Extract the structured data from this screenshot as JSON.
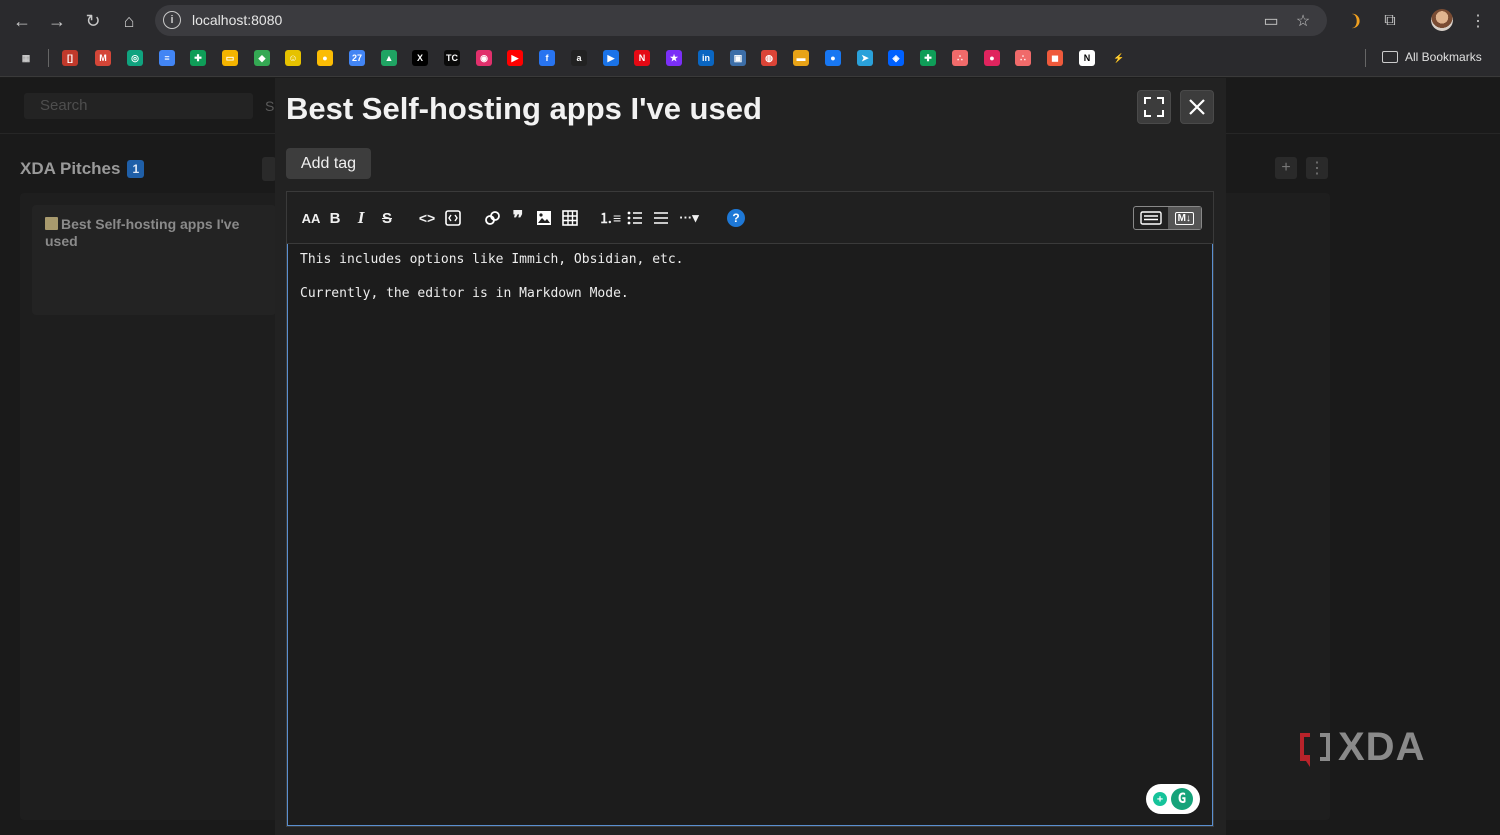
{
  "browser": {
    "url": "localhost:8080",
    "all_bookmarks_label": "All Bookmarks"
  },
  "bookmarks": [
    {
      "icon": "apps-icon",
      "color": "#2a2a2d",
      "glyph": "▦"
    },
    {
      "icon": "bracket-icon",
      "color": "#c0392b",
      "glyph": "[]"
    },
    {
      "icon": "gmail-icon",
      "color": "#d44638",
      "glyph": "M"
    },
    {
      "icon": "chatgpt-icon",
      "color": "#10a37f",
      "glyph": "◎"
    },
    {
      "icon": "docs-icon",
      "color": "#4285f4",
      "glyph": "≡"
    },
    {
      "icon": "sheets-icon",
      "color": "#0f9d58",
      "glyph": "✚"
    },
    {
      "icon": "slides-icon",
      "color": "#f4b400",
      "glyph": "▭"
    },
    {
      "icon": "chat-icon",
      "color": "#34a853",
      "glyph": "◆"
    },
    {
      "icon": "smiley-icon",
      "color": "#e6c200",
      "glyph": "☺"
    },
    {
      "icon": "keep-icon",
      "color": "#fbbc04",
      "glyph": "●"
    },
    {
      "icon": "calendar-icon",
      "color": "#4285f4",
      "glyph": "27"
    },
    {
      "icon": "drive-icon",
      "color": "#1fa463",
      "glyph": "▲"
    },
    {
      "icon": "x-icon",
      "color": "#000000",
      "glyph": "X"
    },
    {
      "icon": "tc-icon",
      "color": "#0a0a0a",
      "glyph": "TC"
    },
    {
      "icon": "instagram-icon",
      "color": "#e1306c",
      "glyph": "◉"
    },
    {
      "icon": "youtube-icon",
      "color": "#ff0000",
      "glyph": "▶"
    },
    {
      "icon": "flipkart-icon",
      "color": "#2874f0",
      "glyph": "f"
    },
    {
      "icon": "amazon-icon",
      "color": "#222222",
      "glyph": "a"
    },
    {
      "icon": "play-icon",
      "color": "#1a73e8",
      "glyph": "▶"
    },
    {
      "icon": "netflix-icon",
      "color": "#e50914",
      "glyph": "N"
    },
    {
      "icon": "star-app-icon",
      "color": "#7b2ff7",
      "glyph": "★"
    },
    {
      "icon": "linkedin-icon",
      "color": "#0a66c2",
      "glyph": "in"
    },
    {
      "icon": "news-icon",
      "color": "#3c6ea8",
      "glyph": "▣"
    },
    {
      "icon": "chrome-icon",
      "color": "#db4437",
      "glyph": "◍"
    },
    {
      "icon": "box-icon",
      "color": "#e8a317",
      "glyph": "▬"
    },
    {
      "icon": "message-icon",
      "color": "#1877f2",
      "glyph": "●"
    },
    {
      "icon": "telegram-icon",
      "color": "#2aa1da",
      "glyph": "➤"
    },
    {
      "icon": "dropbox-icon",
      "color": "#0061ff",
      "glyph": "◈"
    },
    {
      "icon": "sheets2-icon",
      "color": "#0f9d58",
      "glyph": "✚"
    },
    {
      "icon": "asana-icon",
      "color": "#f06a6a",
      "glyph": "∴"
    },
    {
      "icon": "red-circle-icon",
      "color": "#e0245e",
      "glyph": "●"
    },
    {
      "icon": "asana2-icon",
      "color": "#f06a6a",
      "glyph": "∴"
    },
    {
      "icon": "red-square-icon",
      "color": "#ef5a3c",
      "glyph": "◼"
    },
    {
      "icon": "notion-icon",
      "color": "#ffffff",
      "glyph": "N"
    },
    {
      "icon": "bolt-icon",
      "color": "#2a2a2d",
      "glyph": "⚡"
    }
  ],
  "background": {
    "search_placeholder": "Search",
    "partial_label": "S",
    "column_title": "XDA Pitches",
    "column_count": "1",
    "card_title": "Best Self-hosting apps I've used",
    "watermark": "XDA"
  },
  "modal": {
    "title": "Best Self-hosting apps I've used",
    "add_tag_label": "Add tag",
    "content_lines": [
      "This includes options like Immich, Obsidian, etc.",
      "Currently, the editor is in Markdown Mode."
    ],
    "mode_markdown_label": "M↓"
  },
  "colors": {
    "accent": "#1e78d6",
    "badge": "#1f5fa8",
    "grammarly": "#15c39a"
  }
}
